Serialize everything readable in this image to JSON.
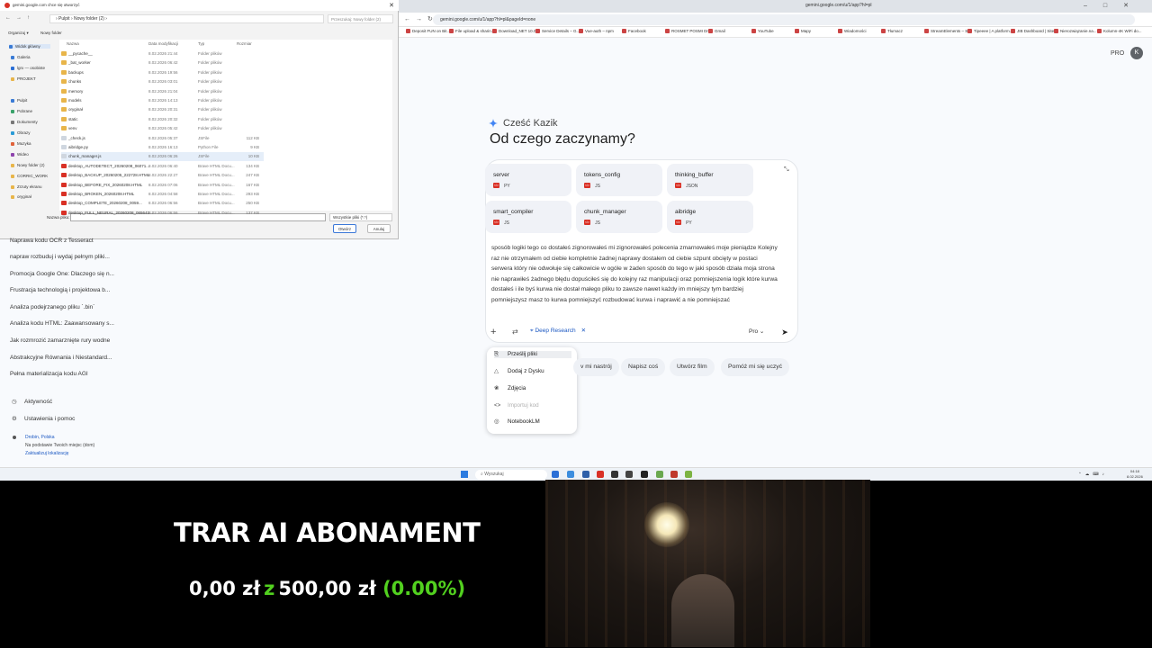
{
  "browser": {
    "tab_title": "gemini.google.com/u/1/app?hl=pl",
    "url": "gemini.google.com/u/1/app?hl=pl&pageId=none",
    "bookmarks": [
      "Deposit FUN on Bit...",
      "File upload & sharin...",
      "Download_NET 10.0...",
      "Service Details – G...",
      "Vue-auth – npm",
      "Facebook",
      "ROSMET POSMI Dr...",
      "Gmail",
      "YouTube",
      "Mapy",
      "Wiadomości",
      "Tłumacz",
      "StreamElements – S...",
      "Tipeeee | A platform...",
      "JIB Dashboard | Site...",
      "Nierozwiązanie.na...",
      "Kolumn-4K WiFi do..."
    ],
    "plan_label": "PRO",
    "avatar_letter": "K"
  },
  "sidebar": {
    "chats": [
      "Naprawa kodu OCR z Tesseract",
      "napraw rozbuduj i wydaj pełnym pliki...",
      "Promocja Google One: Dlaczego się n...",
      "Frustracja technologią i projektowa b...",
      "Analiza podejrzanego pliku `.bin`",
      "Analiza kodu HTML: Zaawansowany s...",
      "Jak rozmrozić zamarznięte rury wodne",
      "Abstrakcyjne Równania i Niestandard...",
      "Pełna materializacja kodu AGI"
    ],
    "activity": "Aktywność",
    "settings": "Ustawienia i pomoc",
    "location_city": "Drobin, Polska",
    "location_basis": "Na podstawie Twoich miejsc (dom)",
    "location_update": "Zaktualizuj lokalizację"
  },
  "main": {
    "greeting": "Cześć Kazik",
    "headline": "Od czego zaczynamy?",
    "files": [
      {
        "name": "server",
        "type": "PY"
      },
      {
        "name": "tokens_config",
        "type": "JS"
      },
      {
        "name": "thinking_buffer",
        "type": "JSON"
      },
      {
        "name": "smart_compiler",
        "type": "JS"
      },
      {
        "name": "chunk_manager",
        "type": "JS"
      },
      {
        "name": "aibridge",
        "type": "PY"
      }
    ],
    "prompt": "sposób logiki tego co dostałeś zignorowałeś mi zignorowałeś polecenia zmarnowałeś moje pieniądze Kolejny raz nie otrzymałem od ciebie kompletnie żadnej naprawy dostałem od ciebie szpunt obcięty w postaci serwera który nie odwołuje się całkowicie w ogóle w żaden sposób do tego w jaki sposób działa moja strona nie naprawiłeś żadnego błędu dopuściłeś się do kolejny raz manipulacji oraz pomniejszenia logik które kurwa dostałeś i ile byś kurwa nie dostał małego pliku to zawsze nawet każdy im mniejszy tym bardziej pomniejszysz masz to kurwa pomniejszyć rozbudować kurwa i naprawić a nie pomniejszać",
    "deep_research": "Deep Research",
    "model": "Pro",
    "menu": [
      "Prześlij pliki",
      "Dodaj z Dysku",
      "Zdjęcia",
      "Importuj kod",
      "NotebookLM"
    ],
    "suggestions": [
      "v mi nastrój",
      "Napisz coś",
      "Utwórz film",
      "Pomóż mi się uczyć"
    ]
  },
  "dialog": {
    "title": "gemini.google.com chce się otworzyć",
    "path": "›  Pulpit  ›  Nowy folder (2)  ›",
    "search_placeholder": "Przeszukaj: Nowy folder (2)",
    "organize": "Organizuj ▾",
    "new_folder": "Nowy folder",
    "columns": [
      "Nazwa",
      "Data modyfikacji",
      "Typ",
      "Rozmiar"
    ],
    "nav": [
      "Widok główny",
      "Galeria",
      "lgrx — osobiste",
      "PROJEKT",
      "Pulpit",
      "Pobrane",
      "Dokumenty",
      "Obrazy",
      "Muzyka",
      "Wideo",
      "Nowy folder (2)",
      "CORRIC_WORK",
      "Zrzuty ekranu",
      "oryginał"
    ],
    "files": [
      {
        "name": "__pycache__",
        "date": "8.02.2026 21:44",
        "kind": "Folder plików",
        "size": ""
      },
      {
        "name": "_bat_worker",
        "date": "8.02.2026 06:42",
        "kind": "Folder plików",
        "size": ""
      },
      {
        "name": "backups",
        "date": "8.02.2026 19:56",
        "kind": "Folder plików",
        "size": ""
      },
      {
        "name": "chunks",
        "date": "8.02.2026 03:01",
        "kind": "Folder plików",
        "size": ""
      },
      {
        "name": "memory",
        "date": "8.02.2026 21:04",
        "kind": "Folder plików",
        "size": ""
      },
      {
        "name": "models",
        "date": "8.02.2026 14:13",
        "kind": "Folder plików",
        "size": ""
      },
      {
        "name": "oryginał",
        "date": "8.02.2026 20:31",
        "kind": "Folder plików",
        "size": ""
      },
      {
        "name": "static",
        "date": "8.02.2026 20:32",
        "kind": "Folder plików",
        "size": ""
      },
      {
        "name": "venv",
        "date": "8.02.2026 05:42",
        "kind": "Folder plików",
        "size": ""
      },
      {
        "name": "_check.js",
        "date": "8.02.2026 05:37",
        "kind": "JSFile",
        "size": "112 KB"
      },
      {
        "name": "aibridge.py",
        "date": "8.02.2026 16:13",
        "kind": "Python File",
        "size": "9 KB"
      },
      {
        "name": "chunk_manager.js",
        "date": "8.02.2026 06:26",
        "kind": "JSFile",
        "size": "10 KB"
      },
      {
        "name": "desktop_AUTODETECT_20260208_06071...",
        "date": "8.02.2026 06:40",
        "kind": "Brave HTML Docu...",
        "size": "134 KB"
      },
      {
        "name": "desktop_BACKUP_20260205_222728.HTML",
        "date": "8.02.2026 22:27",
        "kind": "Brave HTML Docu...",
        "size": "247 KB"
      },
      {
        "name": "desktop_BEFORE_FIX_20260208.HTML",
        "date": "8.02.2026 07:06",
        "kind": "Brave HTML Docu...",
        "size": "167 KB"
      },
      {
        "name": "desktop_BROKEN_20260208.HTML",
        "date": "8.02.2026 04:58",
        "kind": "Brave HTML Docu...",
        "size": "293 KB"
      },
      {
        "name": "desktop_COMPLETE_20260208_0059...",
        "date": "8.02.2026 06:56",
        "kind": "Brave HTML Docu...",
        "size": "250 KB"
      },
      {
        "name": "desktop_FULL_NEURAL_20260208_065641...",
        "date": "8.02.2026 06:56",
        "kind": "Brave HTML Docu...",
        "size": "137 KB"
      }
    ],
    "filename_label": "Nazwa pliku:",
    "filetype": "Wszystkie pliki (*.*)",
    "open_button": "Otwórz",
    "cancel_button": "Anuluj"
  },
  "taskbar": {
    "search_placeholder": "Wyszukaj",
    "time": "04:18",
    "date": "8.02.2026"
  },
  "overlay": {
    "title": "TRAR AI ABONAMENT",
    "amount": "0,00 zł",
    "connector": "z",
    "target": "500,00 zł",
    "percent": "(0.00%)",
    "progress_fraction": 0.0
  }
}
